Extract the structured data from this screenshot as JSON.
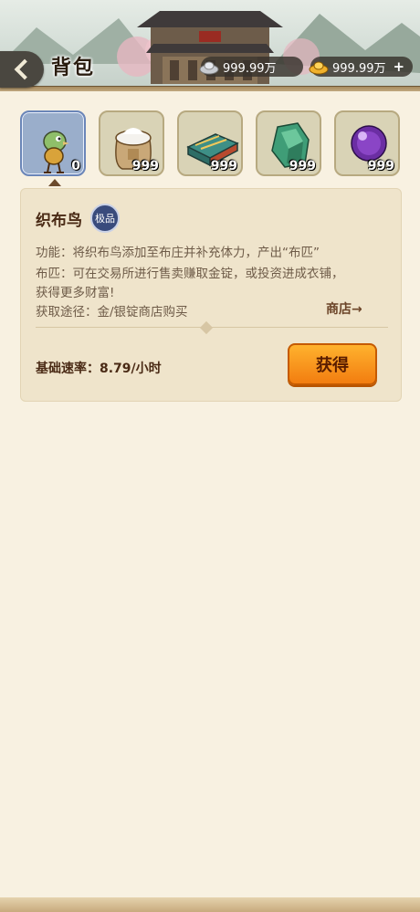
{
  "header": {
    "title": "背包",
    "silver_amount": "999.99万",
    "gold_amount": "999.99万",
    "add_label": "+"
  },
  "items": [
    {
      "name": "织布鸟",
      "icon": "weaver-bird-icon",
      "qty": "0",
      "selected": true
    },
    {
      "name": "布袋",
      "icon": "cloth-sack-icon",
      "qty": "999"
    },
    {
      "name": "布匹",
      "icon": "fabric-bolt-icon",
      "qty": "999"
    },
    {
      "name": "玉石",
      "icon": "jade-stone-icon",
      "qty": "999"
    },
    {
      "name": "宝珠",
      "icon": "purple-orb-icon",
      "qty": "999"
    }
  ],
  "detail": {
    "name": "织布鸟",
    "grade": "极品",
    "line1": "功能：将织布鸟添加至布庄并补充体力，产出“布匹”",
    "line2": "布匹：可在交易所进行售卖赚取金锭，或投资进成衣铺，",
    "line3": "获得更多财富!",
    "source": "获取途径：金/银锭商店购买",
    "shop_link": "商店→",
    "speed": "基础速率：8.79/小时",
    "obtain_button": "获得"
  },
  "colors": {
    "accent_orange": "#f27d10",
    "grade_badge": "#394b7c",
    "panel": "#efe4cb",
    "background": "#f8f1e1"
  }
}
